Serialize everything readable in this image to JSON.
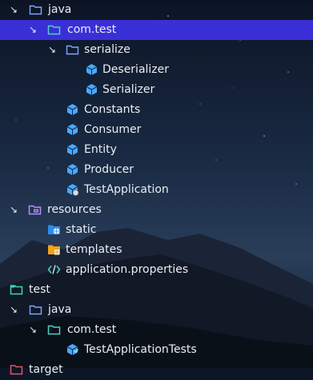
{
  "tree": {
    "rows": [
      {
        "label": "java",
        "icon": "folder-icon",
        "expanded": true
      },
      {
        "label": "com.test",
        "icon": "package-folder-icon",
        "expanded": true,
        "selected": true
      },
      {
        "label": "serialize",
        "icon": "folder-icon",
        "expanded": true
      },
      {
        "label": "Deserializer",
        "icon": "class-icon"
      },
      {
        "label": "Serializer",
        "icon": "class-icon"
      },
      {
        "label": "Constants",
        "icon": "class-icon"
      },
      {
        "label": "Consumer",
        "icon": "class-icon"
      },
      {
        "label": "Entity",
        "icon": "class-icon"
      },
      {
        "label": "Producer",
        "icon": "class-icon"
      },
      {
        "label": "TestApplication",
        "icon": "spring-app-class-icon"
      },
      {
        "label": "resources",
        "icon": "resources-folder-icon",
        "expanded": true
      },
      {
        "label": "static",
        "icon": "web-folder-icon"
      },
      {
        "label": "templates",
        "icon": "templates-folder-icon"
      },
      {
        "label": "application.properties",
        "icon": "properties-file-icon"
      },
      {
        "label": "test",
        "icon": "module-folder-icon",
        "expanded": true
      },
      {
        "label": "java",
        "icon": "folder-icon",
        "expanded": true
      },
      {
        "label": "com.test",
        "icon": "package-folder-icon",
        "expanded": true
      },
      {
        "label": "TestApplicationTests",
        "icon": "test-class-icon"
      },
      {
        "label": "target",
        "icon": "module-folder-icon"
      }
    ]
  },
  "colors": {
    "selection": "#3a2fd6",
    "folder": "#7ea7ff",
    "package_folder": "#4fd1c5",
    "class_cube": "#4aa8ff",
    "resources_folder": "#b58cff",
    "module_folder": "#3ad6b0",
    "text": "#e9eef5"
  }
}
